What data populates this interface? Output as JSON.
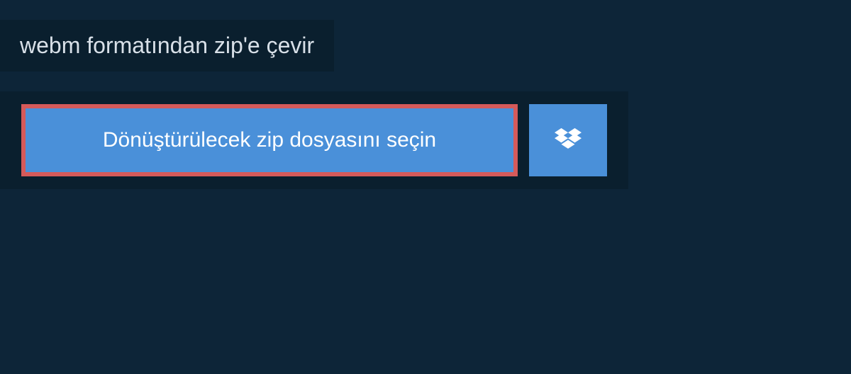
{
  "header": {
    "title": "webm formatından zip'e çevir"
  },
  "panel": {
    "file_select_label": "Dönüştürülecek zip dosyasını seçin"
  },
  "colors": {
    "page_bg": "#0d2538",
    "panel_bg": "#0a1f2e",
    "button_bg": "#4a90d9",
    "button_border": "#d55a5a",
    "text_light": "#d8e0e8",
    "text_white": "#ffffff"
  }
}
